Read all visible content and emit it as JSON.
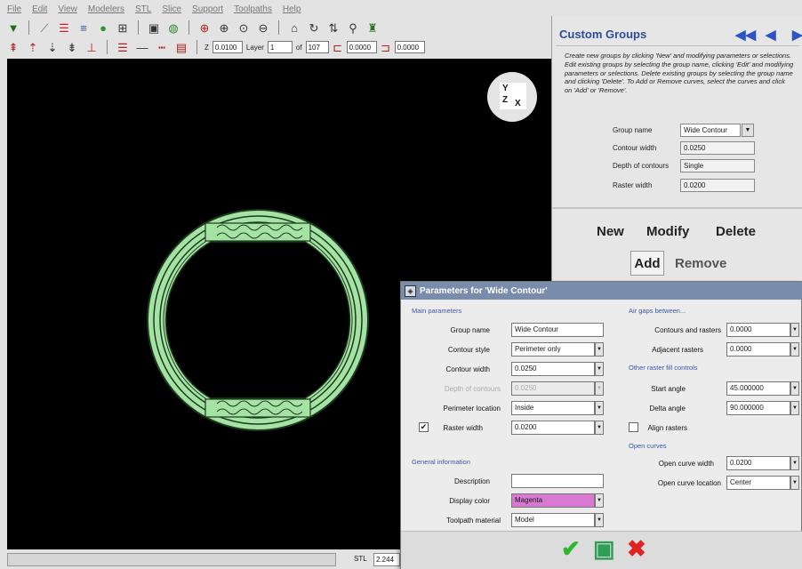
{
  "menu": [
    "File",
    "Edit",
    "View",
    "Modelers",
    "STL",
    "Slice",
    "Support",
    "Toolpaths",
    "Help"
  ],
  "toolbar2": {
    "z_label": "Z",
    "z_value": "0.0100",
    "layer_label": "Layer",
    "layer_value": "1",
    "of_label": "of",
    "layer_total": "107",
    "field_a": "0.0000",
    "field_b": "0.0000"
  },
  "viewport": {
    "background": "#000000",
    "ring_color": "#a5e3a5",
    "ring_edge_color": "#1c3a1c",
    "gizmo_axes": [
      "Y",
      "Z",
      "X"
    ]
  },
  "statusbar": {
    "stl_label": "STL",
    "stl_value": "2.244"
  },
  "panel": {
    "title": "Custom Groups",
    "nav": [
      "◀◀",
      "◀",
      "▶"
    ],
    "description": "Create new groups by clicking 'New' and modifying parameters or selections. Edit existing groups by selecting the group name, clicking 'Edit' and modifying parameters or selections. Delete existing groups by selecting the group name and clicking 'Delete'. To Add or Remove curves, select the curves and click on 'Add' or 'Remove'.",
    "fields": [
      {
        "label": "Group name",
        "value": "Wide Contour"
      },
      {
        "label": "Contour width",
        "value": "0.0250"
      },
      {
        "label": "Depth of contours",
        "value": "Single"
      },
      {
        "label": "Raster width",
        "value": "0.0200"
      }
    ],
    "buttons": {
      "new": "New",
      "modify": "Modify",
      "delete": "Delete",
      "add": "Add",
      "remove": "Remove"
    }
  },
  "dialog": {
    "title": "Parameters for 'Wide Contour'",
    "main_params_header": "Main parameters",
    "group_name": {
      "label": "Group name",
      "value": "Wide Contour"
    },
    "contour_style": {
      "label": "Contour style",
      "value": "Perimeter only"
    },
    "contour_width": {
      "label": "Contour width",
      "value": "0.0250"
    },
    "depth_contours": {
      "label": "Depth of contours",
      "value": "0.0250"
    },
    "perimeter_location": {
      "label": "Perimeter location",
      "value": "Inside"
    },
    "raster_width": {
      "label": "Raster width",
      "value": "0.0200",
      "checked": true
    },
    "general_header": "General information",
    "description": {
      "label": "Description",
      "value": ""
    },
    "display_color": {
      "label": "Display color",
      "value": "Magenta",
      "swatch": "#d97ad2"
    },
    "toolpath_material": {
      "label": "Toolpath material",
      "value": "Model"
    },
    "air_gaps_header": "Air gaps between...",
    "contours_rasters": {
      "label": "Contours and rasters",
      "value": "0.0000"
    },
    "adjacent_rasters": {
      "label": "Adjacent rasters",
      "value": "0.0000"
    },
    "raster_fill_header": "Other raster fill controls",
    "start_angle": {
      "label": "Start angle",
      "value": "45.000000"
    },
    "delta_angle": {
      "label": "Delta angle",
      "value": "90.000000"
    },
    "align_rasters": {
      "label": "Align rasters",
      "checked": false
    },
    "open_curves_header": "Open curves",
    "open_curve_width": {
      "label": "Open curve width",
      "value": "0.0200"
    },
    "open_curve_location": {
      "label": "Open curve location",
      "value": "Center"
    },
    "footer": {
      "ok_color": "#2fb52f",
      "apply_color": "#2f9e55",
      "cancel_color": "#e02222"
    }
  }
}
